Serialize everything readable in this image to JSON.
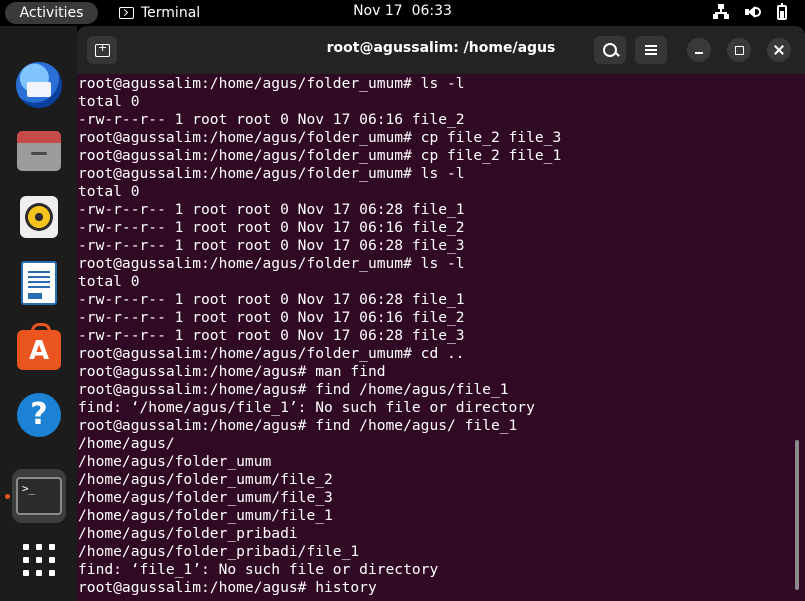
{
  "topbar": {
    "activities": "Activities",
    "app_name": "Terminal",
    "date": "Nov 17",
    "time": "06:33"
  },
  "dock": {
    "items": [
      {
        "name": "thunderbird",
        "icon": "thunderbird-icon"
      },
      {
        "name": "files",
        "icon": "folder-icon"
      },
      {
        "name": "rhythmbox",
        "icon": "speaker-icon"
      },
      {
        "name": "libreoffice-writer",
        "icon": "document-icon"
      },
      {
        "name": "ubuntu-software",
        "icon": "store-bag-icon",
        "glyph": "A"
      },
      {
        "name": "help",
        "icon": "question-icon",
        "glyph": "?"
      },
      {
        "name": "terminal",
        "icon": "terminal-icon",
        "glyph": ">_",
        "active": true
      },
      {
        "name": "show-applications",
        "icon": "app-grid-icon"
      }
    ],
    "accent": "#e95420"
  },
  "window": {
    "title": "root@agussalim: /home/agus",
    "background": "#300a24"
  },
  "terminal": {
    "lines": [
      "root@agussalim:/home/agus/folder_umum# ls -l",
      "total 0",
      "-rw-r--r-- 1 root root 0 Nov 17 06:16 file_2",
      "root@agussalim:/home/agus/folder_umum# cp file_2 file_3",
      "root@agussalim:/home/agus/folder_umum# cp file_2 file_1",
      "root@agussalim:/home/agus/folder_umum# ls -l",
      "total 0",
      "-rw-r--r-- 1 root root 0 Nov 17 06:28 file_1",
      "-rw-r--r-- 1 root root 0 Nov 17 06:16 file_2",
      "-rw-r--r-- 1 root root 0 Nov 17 06:28 file_3",
      "root@agussalim:/home/agus/folder_umum# ls -l",
      "total 0",
      "-rw-r--r-- 1 root root 0 Nov 17 06:28 file_1",
      "-rw-r--r-- 1 root root 0 Nov 17 06:16 file_2",
      "-rw-r--r-- 1 root root 0 Nov 17 06:28 file_3",
      "root@agussalim:/home/agus/folder_umum# cd ..",
      "root@agussalim:/home/agus# man find",
      "root@agussalim:/home/agus# find /home/agus/file_1",
      "find: ‘/home/agus/file_1’: No such file or directory",
      "root@agussalim:/home/agus# find /home/agus/ file_1",
      "/home/agus/",
      "/home/agus/folder_umum",
      "/home/agus/folder_umum/file_2",
      "/home/agus/folder_umum/file_3",
      "/home/agus/folder_umum/file_1",
      "/home/agus/folder_pribadi",
      "/home/agus/folder_pribadi/file_1",
      "find: ‘file_1’: No such file or directory",
      "root@agussalim:/home/agus# history"
    ]
  }
}
